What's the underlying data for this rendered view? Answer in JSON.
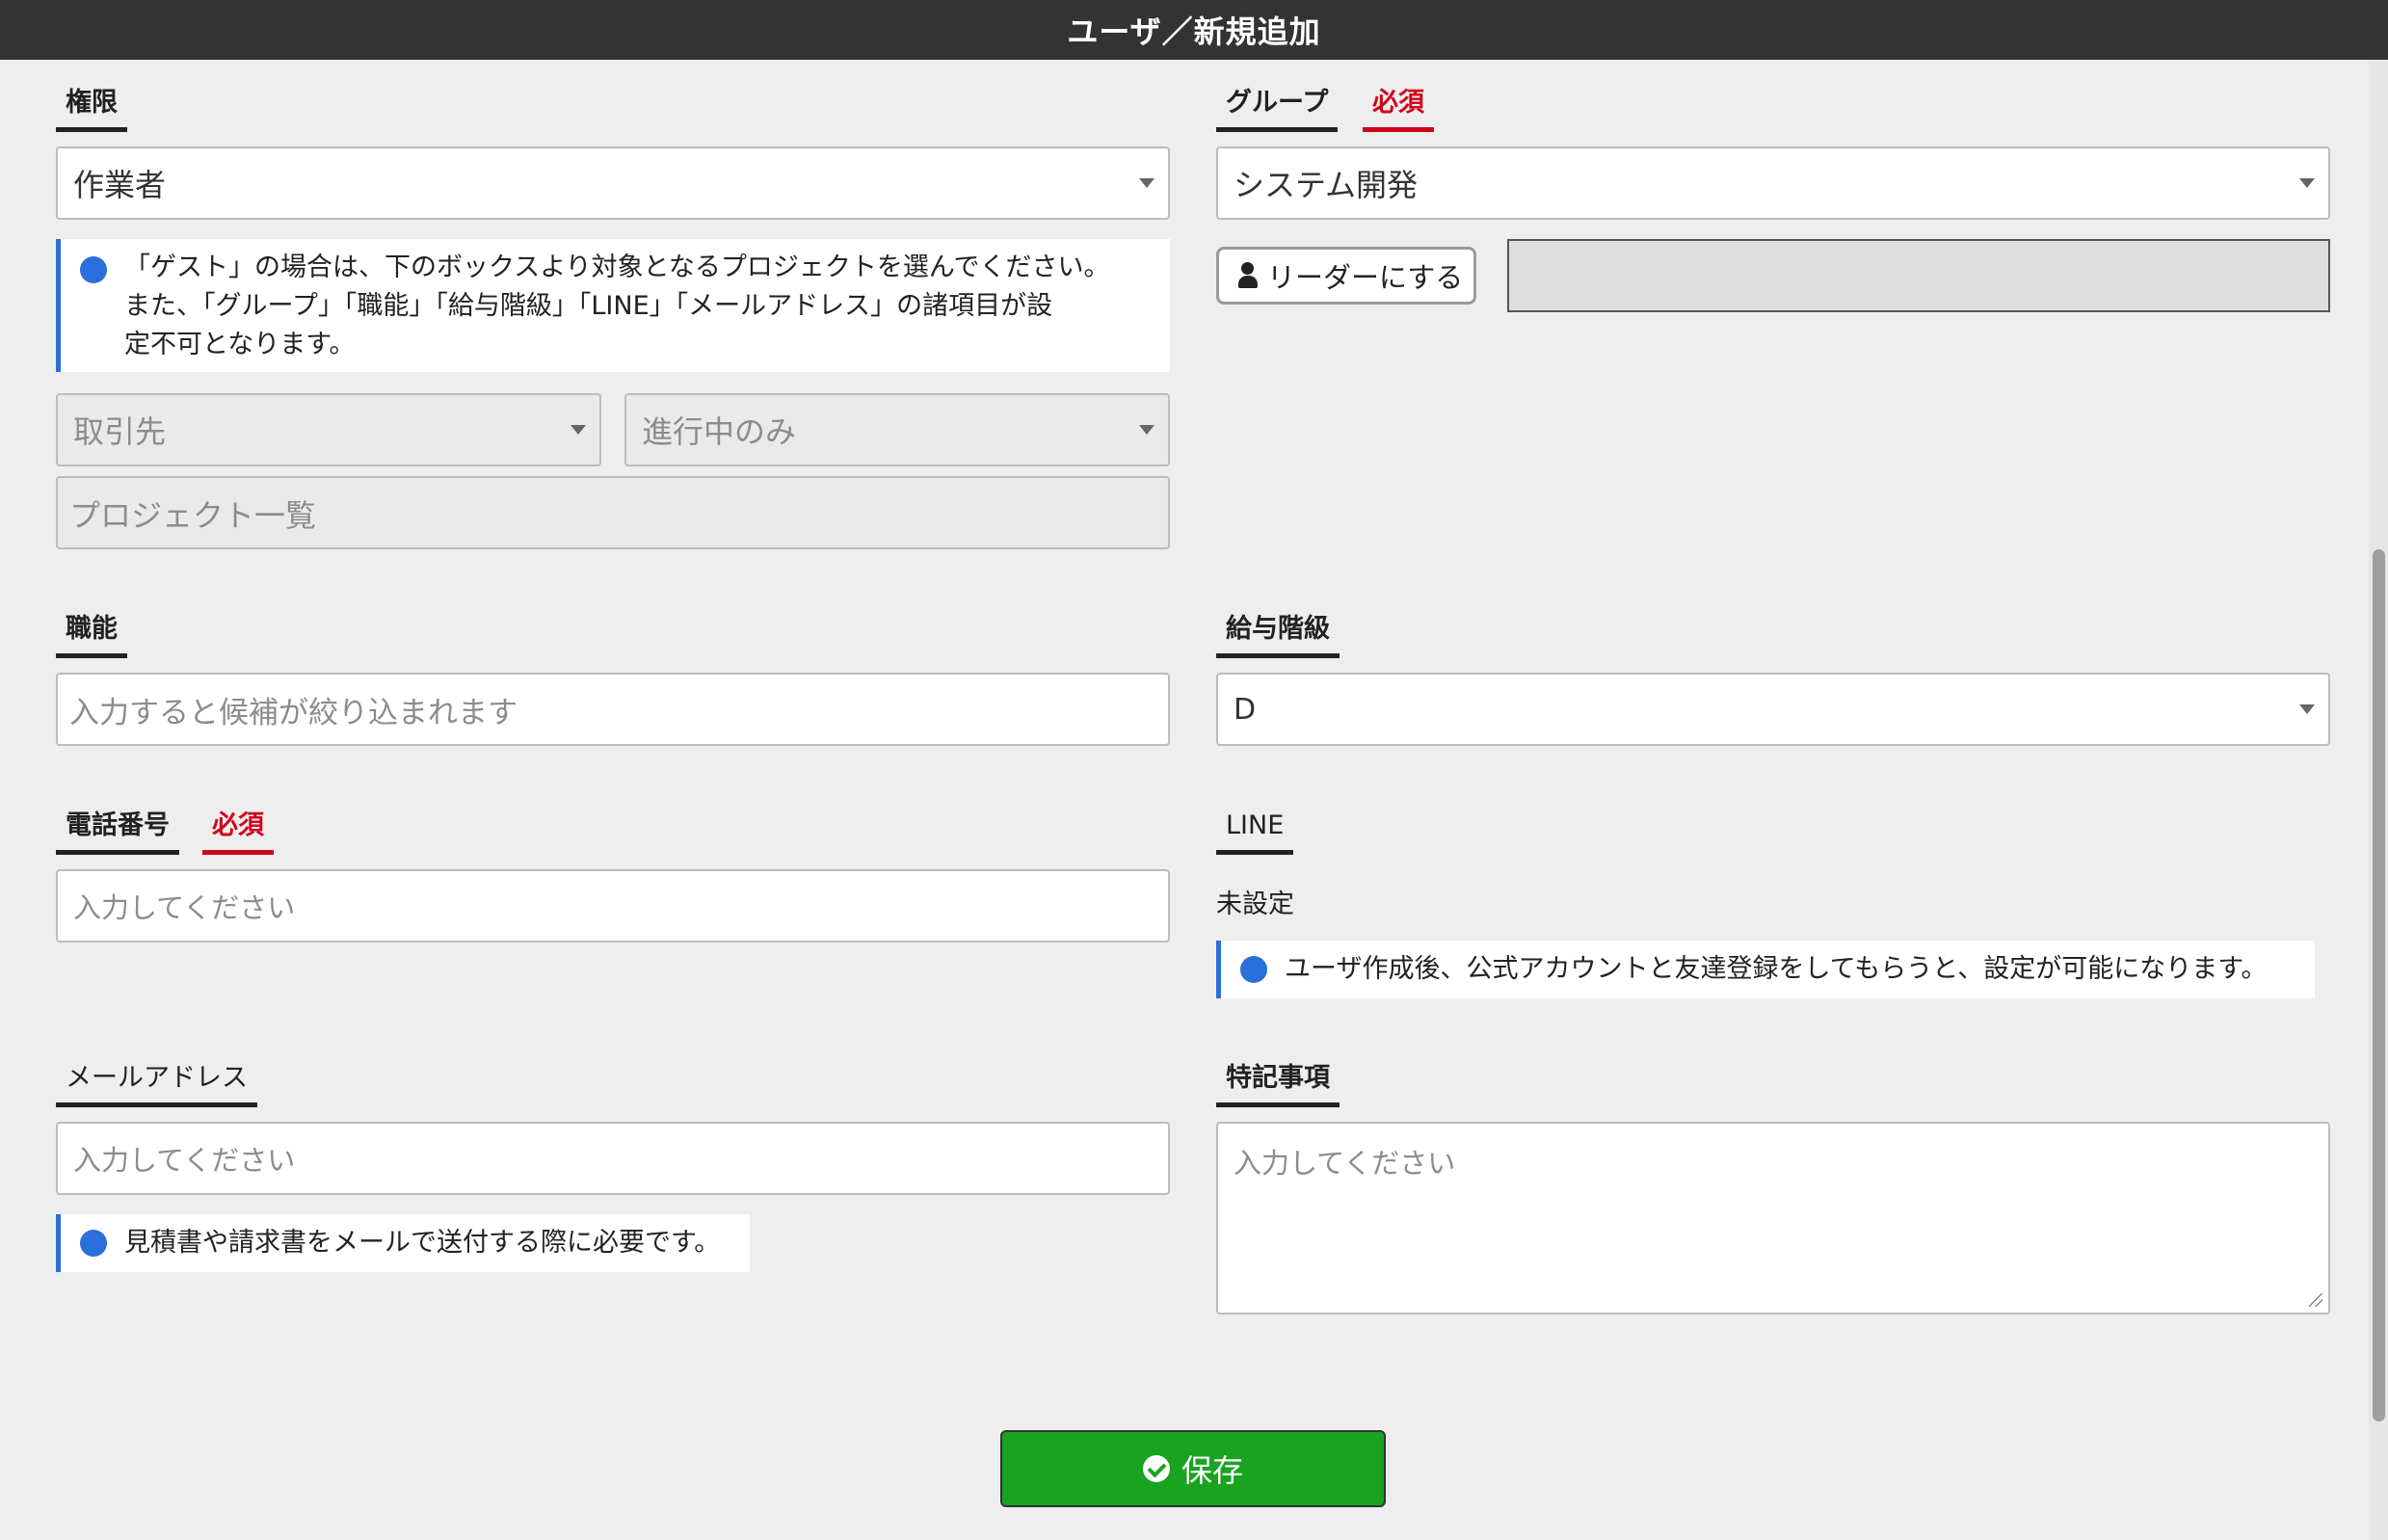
{
  "window": {
    "title": "ユーザ／新規追加"
  },
  "form": {
    "role": {
      "label": "権限",
      "value": "作業者",
      "note_line1": "「ゲスト」の場合は、下のボックスより対象となるプロジェクトを選んでください。",
      "note_line2": "また、「グループ」「職能」「給与階級」「LINE」「メールアドレス」の諸項目が設",
      "note_line3": "定不可となります。",
      "client_placeholder": "取引先",
      "status_placeholder": "進行中のみ",
      "projects_placeholder": "プロジェクト一覧"
    },
    "group": {
      "label": "グループ",
      "required": "必須",
      "value": "システム開発",
      "leader_button": "リーダーにする"
    },
    "skill": {
      "label": "職能",
      "placeholder": "入力すると候補が絞り込まれます"
    },
    "salary_grade": {
      "label": "給与階級",
      "value": "D"
    },
    "phone": {
      "label": "電話番号",
      "required": "必須",
      "placeholder": "入力してください"
    },
    "line": {
      "label": "LINE",
      "status": "未設定",
      "note": "ユーザ作成後、公式アカウントと友達登録をしてもらうと、設定が可能になります。"
    },
    "email": {
      "label": "メールアドレス",
      "placeholder": "入力してください",
      "note": "見積書や請求書をメールで送付する際に必要です。"
    },
    "remarks": {
      "label": "特記事項",
      "placeholder": "入力してください"
    },
    "save_label": "保存"
  },
  "icons": {
    "info": "info-icon",
    "person": "user-icon",
    "check": "check-circle-icon",
    "caret": "chevron-down-icon"
  },
  "colors": {
    "accent_blue": "#2a6fdb",
    "required_red": "#d0021b",
    "save_green": "#1aa321",
    "titlebar": "#333333"
  }
}
